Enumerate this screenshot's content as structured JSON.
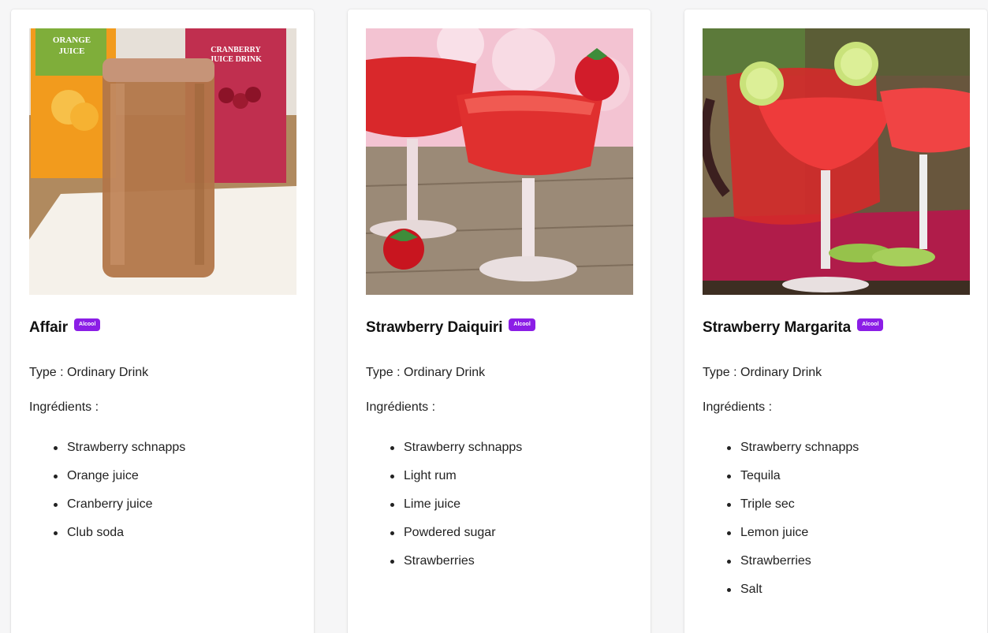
{
  "cards": [
    {
      "title": "Affair",
      "badge": "Alcool",
      "type_line": "Type : Ordinary Drink",
      "ingredients_label": "Ingrédients :",
      "ingredients": [
        "Strawberry schnapps",
        "Orange juice",
        "Cranberry juice",
        "Club soda"
      ],
      "photo": {
        "carton_left": "ORANGE JUICE",
        "carton_right": "CRANBERRY JUICE DRINK"
      }
    },
    {
      "title": "Strawberry Daiquiri",
      "badge": "Alcool",
      "type_line": "Type : Ordinary Drink",
      "ingredients_label": "Ingrédients :",
      "ingredients": [
        "Strawberry schnapps",
        "Light rum",
        "Lime juice",
        "Powdered sugar",
        "Strawberries"
      ]
    },
    {
      "title": "Strawberry Margarita",
      "badge": "Alcool",
      "type_line": "Type : Ordinary Drink",
      "ingredients_label": "Ingrédients :",
      "ingredients": [
        "Strawberry schnapps",
        "Tequila",
        "Triple sec",
        "Lemon juice",
        "Strawberries",
        "Salt"
      ]
    }
  ],
  "colors": {
    "badge": "#8b1ee6",
    "card_bg": "#ffffff",
    "page_bg": "#f6f6f7"
  }
}
